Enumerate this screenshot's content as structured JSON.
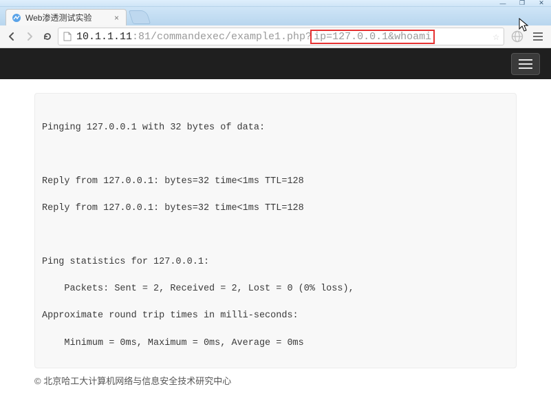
{
  "window": {
    "controls": {
      "minimize": "—",
      "maximize": "❐",
      "close": "✕"
    }
  },
  "tab": {
    "title": "Web渗透测试实验",
    "close_label": "×"
  },
  "toolbar": {
    "back": "←",
    "forward": "→",
    "reload": "↻",
    "url": {
      "host": "10.1.1.11",
      "rest": ":81/commandexec/example1.php?",
      "highlighted": "ip=127.0.0.1&whoami"
    },
    "star": "☆",
    "menu": "≡"
  },
  "page": {
    "output": "\nPinging 127.0.0.1 with 32 bytes of data:\n\n\n\nReply from 127.0.0.1: bytes=32 time<1ms TTL=128\n\nReply from 127.0.0.1: bytes=32 time<1ms TTL=128\n\n\n\nPing statistics for 127.0.0.1:\n\n    Packets: Sent = 2, Received = 2, Lost = 0 (0% loss),\n\nApproximate round trip times in milli-seconds:\n\n    Minimum = 0ms, Maximum = 0ms, Average = 0ms",
    "footer": "© 北京哈工大计算机网络与信息安全技术研究中心"
  }
}
